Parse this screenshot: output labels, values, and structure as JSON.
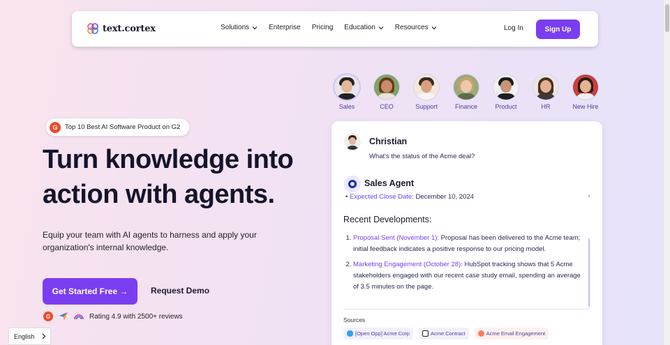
{
  "nav": {
    "logo_text": "text.cortex",
    "menu": [
      {
        "label": "Solutions",
        "dropdown": true
      },
      {
        "label": "Enterprise",
        "dropdown": false
      },
      {
        "label": "Pricing",
        "dropdown": false
      },
      {
        "label": "Education",
        "dropdown": true
      },
      {
        "label": "Resources",
        "dropdown": true
      }
    ],
    "login": "Log In",
    "signup": "Sign Up"
  },
  "hero": {
    "badge": "Top 10 Best AI Software Product on G2",
    "badge_icon": "G",
    "headline_line1": "Turn knowledge into",
    "headline_line2": "action with agents.",
    "subtitle": "Equip your team with AI agents to harness and apply your organization's internal knowledge.",
    "cta_primary": "Get Started Free →",
    "cta_secondary": "Request Demo",
    "rating": "Rating 4.9 with 2500+ reviews"
  },
  "language": {
    "label": "English"
  },
  "agents": [
    {
      "label": "Sales",
      "active": true
    },
    {
      "label": "CEO"
    },
    {
      "label": "Support"
    },
    {
      "label": "Finance"
    },
    {
      "label": "Product"
    },
    {
      "label": "HR"
    },
    {
      "label": "New Hire"
    }
  ],
  "chat": {
    "user_name": "Christian",
    "user_message": "What's the status of the Acme deal?",
    "agent_name": "Sales Agent",
    "close_label": "Expected Close Date:",
    "close_value": "December 10, 2024",
    "dev_title": "Recent Developments:",
    "developments": [
      {
        "head": "Proposal Sent (November 1):",
        "text": " Proposal has been delivered to the Acme team; initial feedback indicates a positive response to our pricing model."
      },
      {
        "head": "Marketing Engagement (October 28):",
        "text": " HubSpot tracking shows that 5 Acme stakeholders engaged with our recent case study email, spending an average of 3.5 minutes on the page."
      }
    ],
    "sources_label": "Sources",
    "sources": [
      "[Open Opp] Acme Corp",
      "Acme Contract",
      "Acme Email Engagement"
    ]
  },
  "colors": {
    "accent": "#7a3ef0",
    "g2": "#ef4a2a"
  }
}
